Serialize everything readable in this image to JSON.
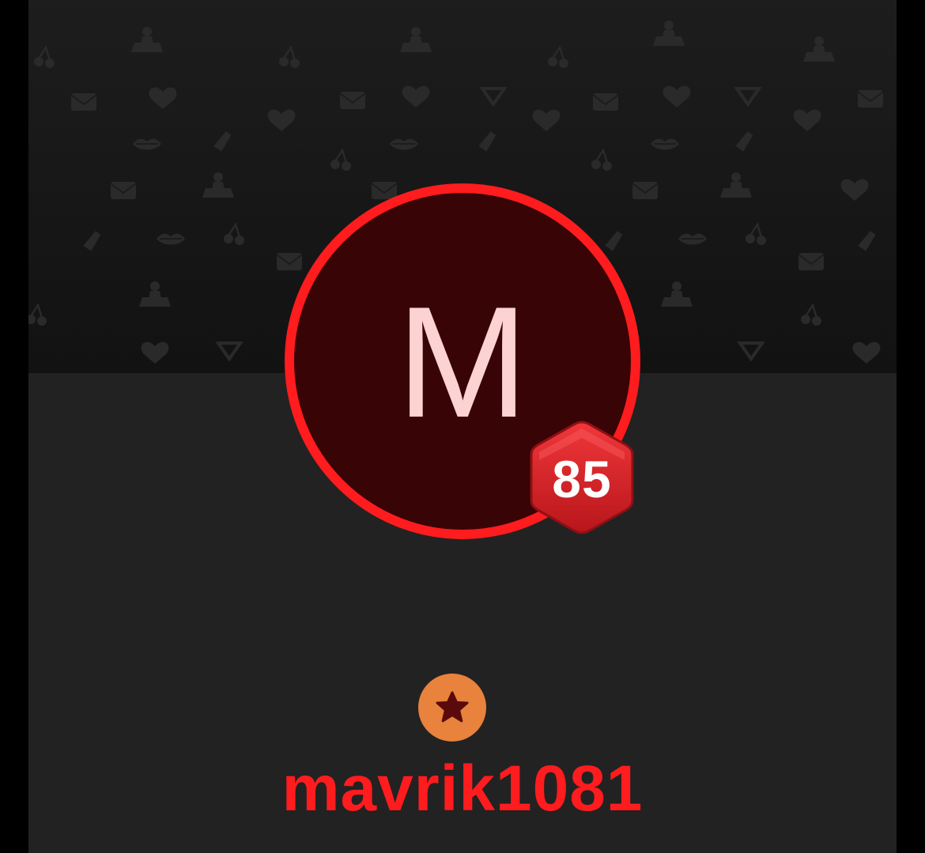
{
  "profile": {
    "avatar_initial": "M",
    "level": "85",
    "username": "mavrik1081",
    "rank_icon": "star-icon",
    "cover_pattern_icons": [
      "person-icon",
      "heart-icon",
      "lips-icon",
      "cherry-icon",
      "diamond-heart-icon",
      "envelope-icon",
      "lipstick-icon"
    ]
  },
  "colors": {
    "background": "#222222",
    "cover": "#191919",
    "accent": "#fe1c1e",
    "avatar_fill": "#380405",
    "avatar_initial": "#fdd2d2",
    "level_badge": "#d9262b",
    "rank_badge": "#e8823c",
    "rank_star": "#5a0a0a"
  }
}
